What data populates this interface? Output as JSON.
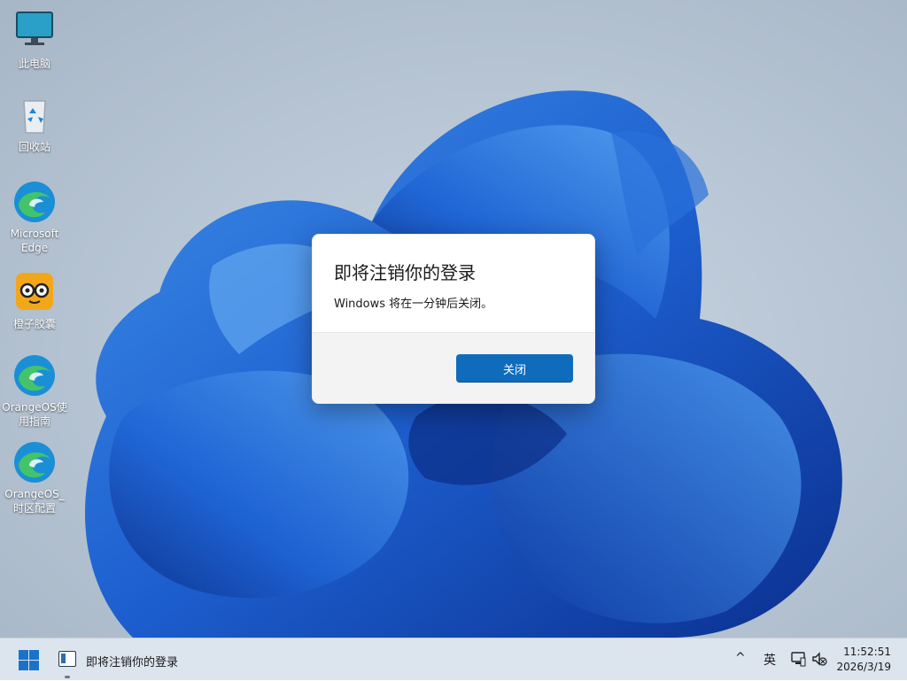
{
  "desktop_icons": [
    {
      "name": "this-pc",
      "label": "此电脑"
    },
    {
      "name": "recycle-bin",
      "label": "回收站"
    },
    {
      "name": "microsoft-edge",
      "label": "Microsoft Edge"
    },
    {
      "name": "orange-capsule",
      "label": "橙子胶囊"
    },
    {
      "name": "orangeos-guide",
      "label": "OrangeOS使用指南"
    },
    {
      "name": "orangeos-timezone",
      "label": "OrangeOS_时区配置"
    }
  ],
  "dialog": {
    "title": "即将注销你的登录",
    "message": "Windows 将在一分钟后关闭。",
    "close_button": "关闭"
  },
  "taskbar": {
    "task_label": "即将注销你的登录",
    "ime_label": "英",
    "chevron": "^",
    "time": "11:52:51",
    "date": "2026/3/19",
    "accent_color": "#0f6cbd"
  }
}
